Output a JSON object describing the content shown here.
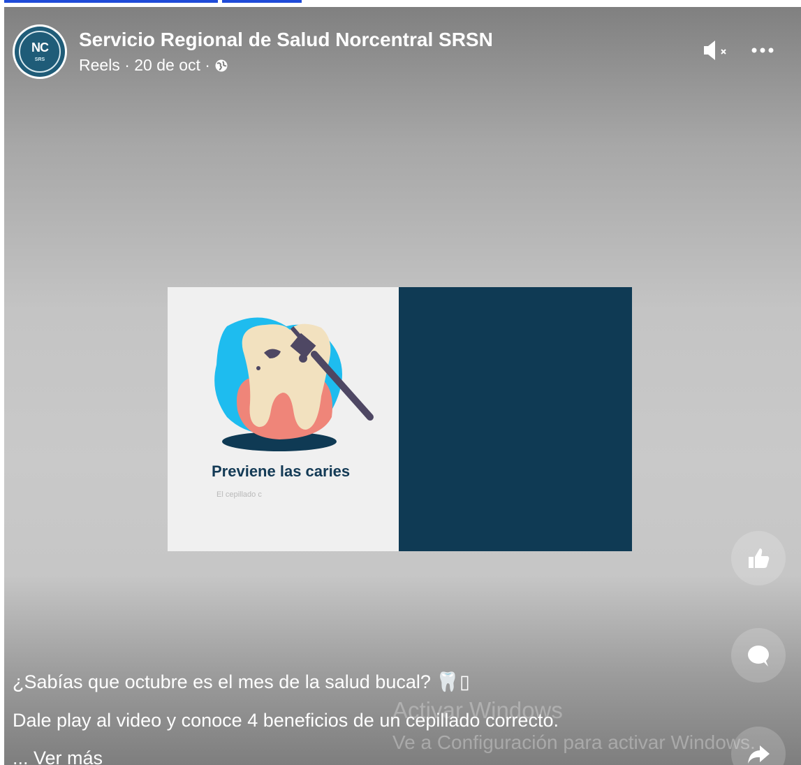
{
  "header": {
    "page_name": "Servicio Regional de Salud Norcentral SRSN",
    "meta_text": "Reels · 20 de oct · ",
    "avatar_initials": "NC",
    "avatar_sub": "SRS"
  },
  "video": {
    "slide_title": "Previene las caries",
    "slide_subtitle": "El cepillado c"
  },
  "caption": {
    "line1": "¿Sabías que octubre es el mes de la salud bucal? 🦷▯",
    "line2": "Dale play al video y conoce 4 beneficios de un cepillado correcto.",
    "see_more": "... Ver más"
  },
  "watermark": {
    "title": "Activar Windows",
    "subtitle": "Ve a Configuración para activar Windows."
  },
  "icons": {
    "mute": "volume-muted-icon",
    "more": "more-options-icon",
    "like": "like-icon",
    "comment": "comment-icon",
    "share": "share-icon",
    "globe": "globe-icon"
  },
  "colors": {
    "slide_dark": "#0f3a54",
    "slide_light": "#f0f0f0",
    "title_text": "#133a55"
  }
}
